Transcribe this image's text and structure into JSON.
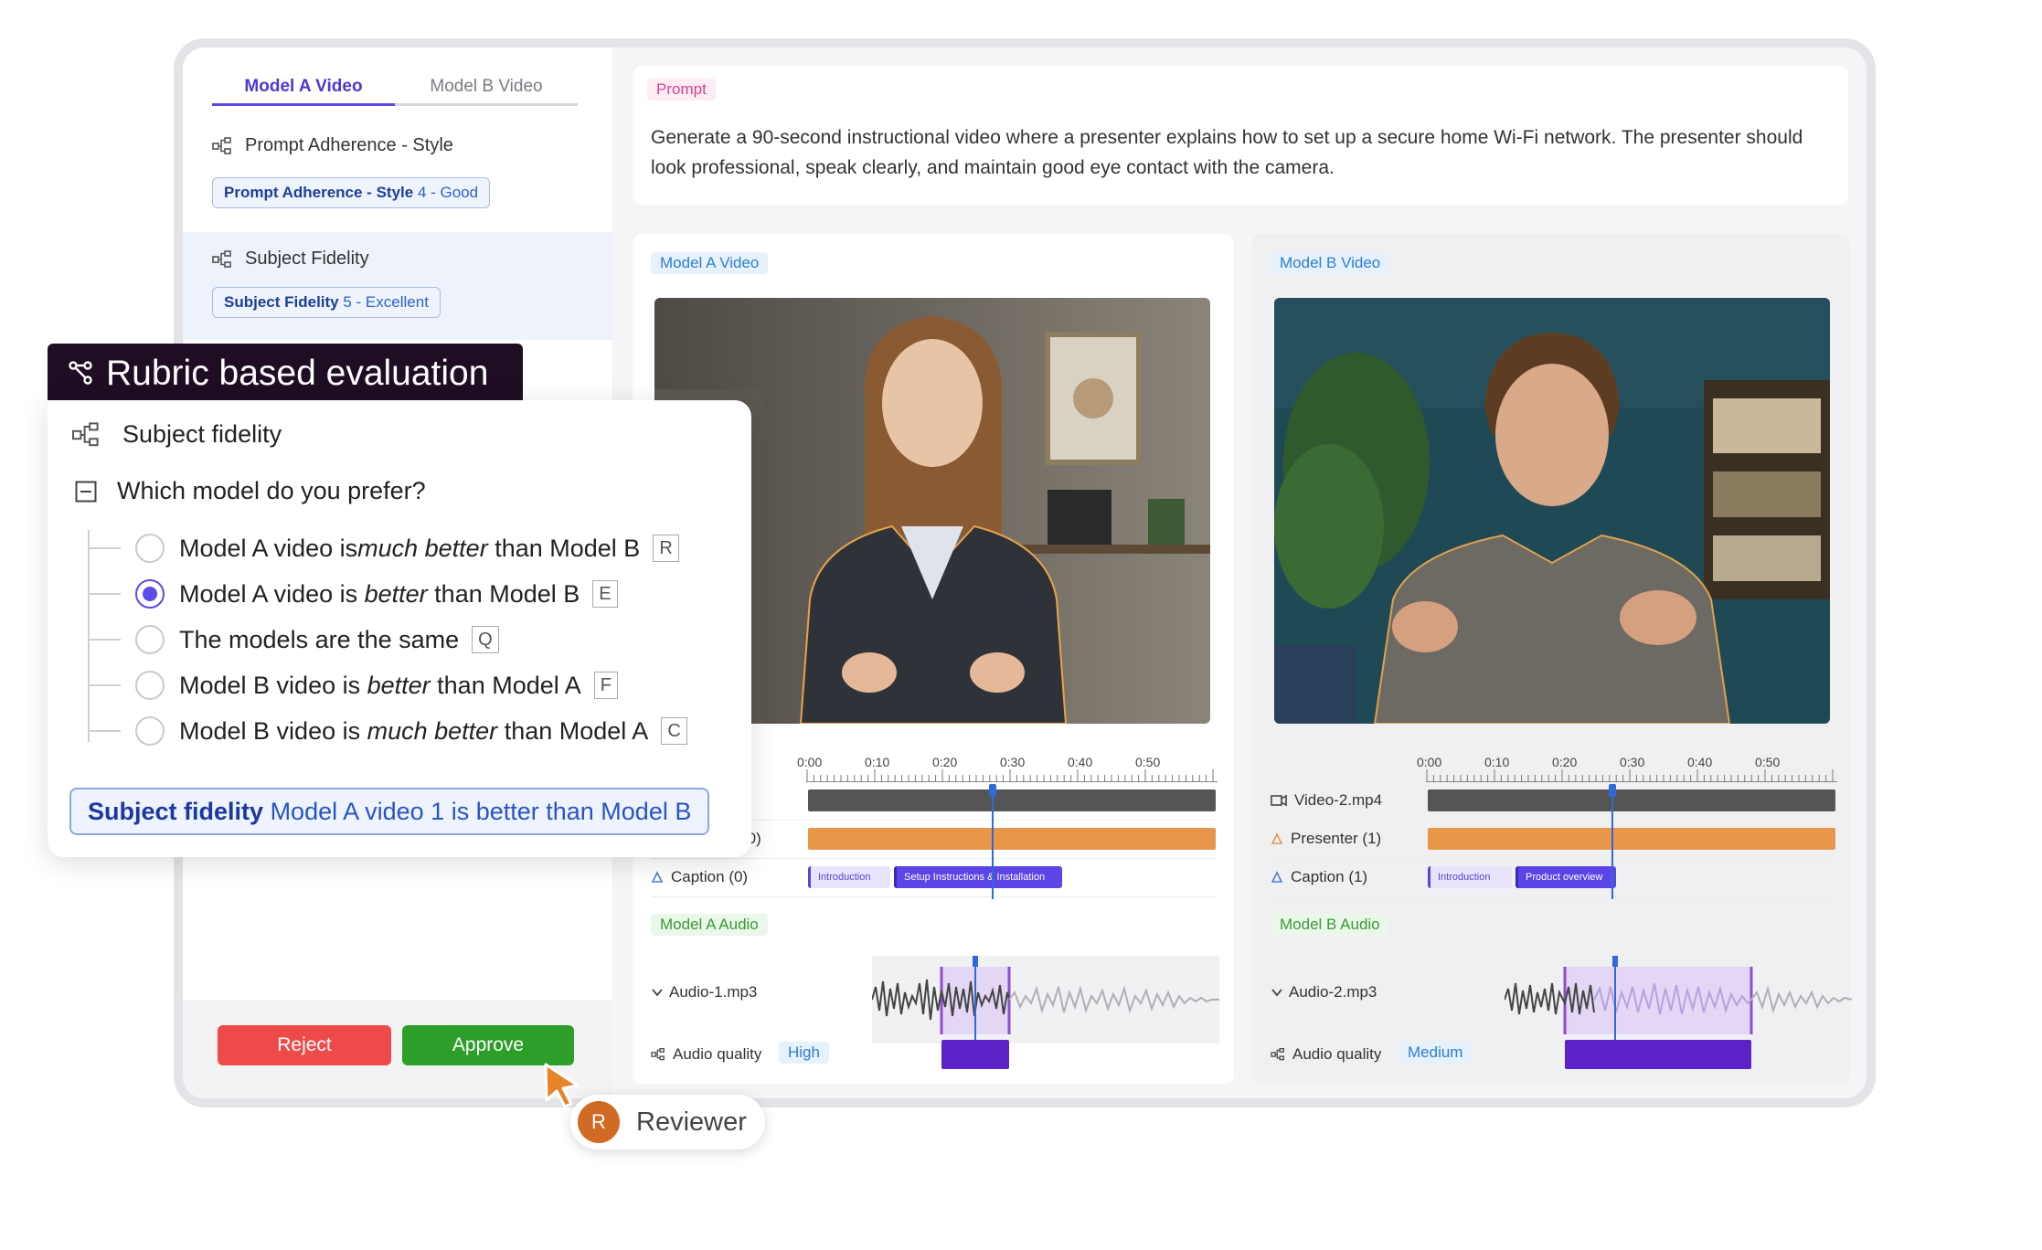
{
  "tabs": [
    {
      "label": "Model A Video",
      "active": true
    },
    {
      "label": "Model B Video",
      "active": false
    }
  ],
  "rubrics": [
    {
      "title": "Prompt Adherence - Style",
      "pill_name": "Prompt Adherence - Style",
      "pill_score": "4 - Good"
    },
    {
      "title": "Subject Fidelity",
      "pill_name": "Subject Fidelity",
      "pill_score": "5 - Excellent"
    }
  ],
  "actions": {
    "reject": "Reject",
    "approve": "Approve"
  },
  "prompt": {
    "tag": "Prompt",
    "text": "Generate a 90-second instructional video where a presenter explains how to set up a secure home Wi-Fi network. The presenter should look professional, speak clearly, and maintain good eye contact with the camera."
  },
  "video_a": {
    "tag": "Model A Video",
    "ruler": [
      "0:00",
      "0:10",
      "0:20",
      "0:30",
      "0:40",
      "0:50"
    ],
    "tracks": [
      {
        "label": "p4",
        "icon": "video-icon"
      },
      {
        "label": "(0)",
        "icon": "presenter-icon"
      },
      {
        "label": "Caption (0)",
        "icon": "caption-icon"
      }
    ],
    "segments": [
      "Introduction",
      "Setup Instructions & Installation"
    ],
    "audio_tag": "Model A Audio",
    "audio_file": "Audio-1.mp3",
    "quality_label": "Audio quality",
    "quality_value": "High"
  },
  "video_b": {
    "tag": "Model B Video",
    "ruler": [
      "0:00",
      "0:10",
      "0:20",
      "0:30",
      "0:40",
      "0:50"
    ],
    "tracks": [
      {
        "label": "Video-2.mp4",
        "icon": "video-icon"
      },
      {
        "label": "Presenter (1)",
        "icon": "presenter-icon"
      },
      {
        "label": "Caption (1)",
        "icon": "caption-icon"
      }
    ],
    "segments": [
      "Introduction",
      "Product overview"
    ],
    "audio_tag": "Model B Audio",
    "audio_file": "Audio-2.mp3",
    "quality_label": "Audio quality",
    "quality_value": "Medium"
  },
  "rubric_panel": {
    "header": "Rubric based evaluation",
    "subject": "Subject fidelity",
    "question": "Which model do you prefer?",
    "options": [
      {
        "pre": "Model A video is ",
        "em": "much better",
        "post": " than Model B",
        "key": "R",
        "checked": false
      },
      {
        "pre": "Model A video is ",
        "em": "better",
        "post": " than Model B",
        "key": "E",
        "checked": true
      },
      {
        "pre": "The models are the same",
        "em": "",
        "post": "",
        "key": "Q",
        "checked": false
      },
      {
        "pre": "Model B video is ",
        "em": "better",
        "post": " than Model A",
        "key": "F",
        "checked": false
      },
      {
        "pre": "Model B video is ",
        "em": "much better",
        "post": " than Model A",
        "key": "C",
        "checked": false
      }
    ],
    "result_name": "Subject fidelity",
    "result_text": "Model A video 1 is better than Model B"
  },
  "reviewer": {
    "initial": "R",
    "name": "Reviewer"
  },
  "colors": {
    "accent": "#5b4be8",
    "reject": "#ef4a4a",
    "approve": "#2e9e2a",
    "presenter": "#e8964a",
    "quality": "#5a22c7"
  }
}
